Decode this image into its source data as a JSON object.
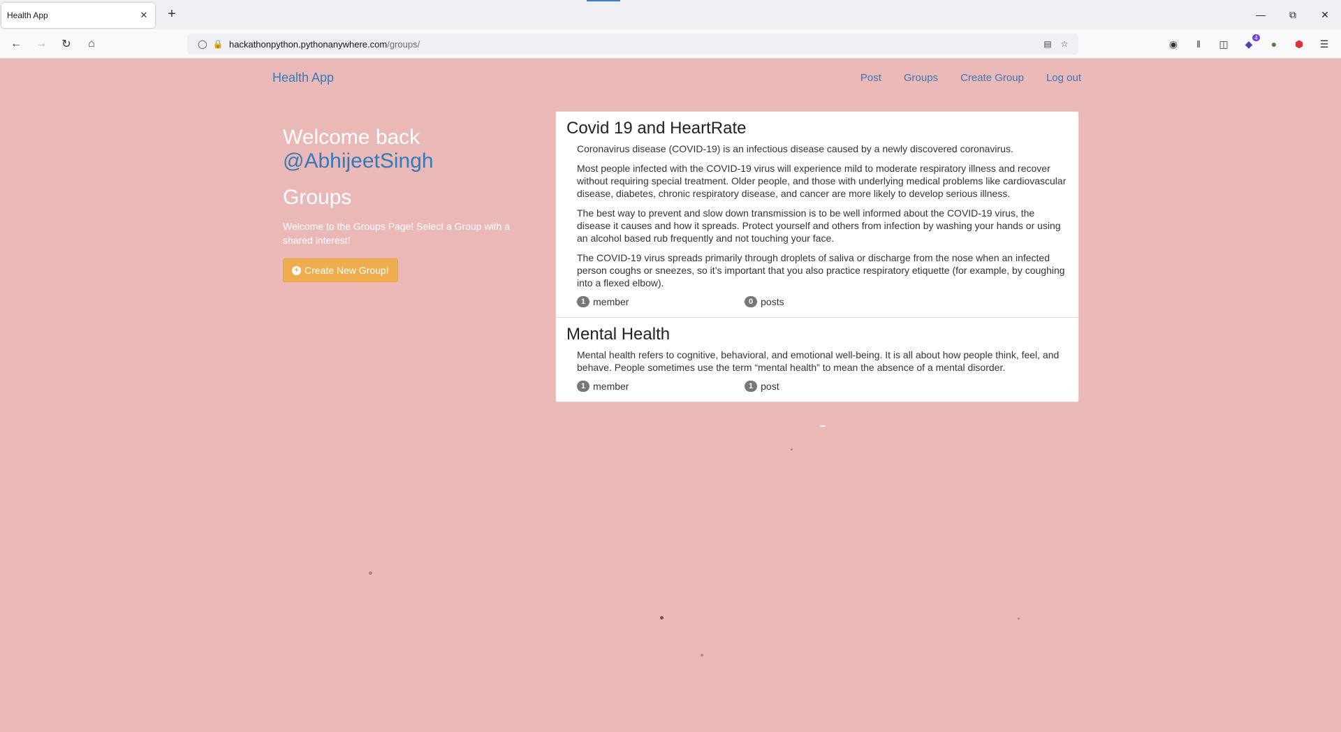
{
  "browser": {
    "tab_title": "Health App",
    "url_host": "hackathonpython.pythonanywhere.com",
    "url_path": "/groups/",
    "extension_badge": "4"
  },
  "site": {
    "brand": "Health App",
    "nav": [
      "Post",
      "Groups",
      "Create Group",
      "Log out"
    ]
  },
  "sidebar": {
    "welcome": "Welcome back",
    "username": "@AbhijeetSingh",
    "title": "Groups",
    "description": "Welcome to the Groups Page! Select a Group with a shared interest!",
    "create_button": "Create New Group!"
  },
  "groups": [
    {
      "title": "Covid 19 and HeartRate",
      "paragraphs": [
        "Coronavirus disease (COVID-19) is an infectious disease caused by a newly discovered coronavirus.",
        "Most people infected with the COVID-19 virus will experience mild to moderate respiratory illness and recover without requiring special treatment. Older people, and those with underlying medical problems like cardiovascular disease, diabetes, chronic respiratory disease, and cancer are more likely to develop serious illness.",
        "The best way to prevent and slow down transmission is to be well informed about the COVID-19 virus, the disease it causes and how it spreads. Protect yourself and others from infection by washing your hands or using an alcohol based rub frequently and not touching your face.",
        "The COVID-19 virus spreads primarily through droplets of saliva or discharge from the nose when an infected person coughs or sneezes, so it’s important that you also practice respiratory etiquette (for example, by coughing into a flexed elbow)."
      ],
      "members_count": "1",
      "members_label": "member",
      "posts_count": "0",
      "posts_label": "posts"
    },
    {
      "title": "Mental Health",
      "paragraphs": [
        "Mental health refers to cognitive, behavioral, and emotional well-being. It is all about how people think, feel, and behave. People sometimes use the term “mental health” to mean the absence of a mental disorder."
      ],
      "members_count": "1",
      "members_label": "member",
      "posts_count": "1",
      "posts_label": "post"
    }
  ]
}
